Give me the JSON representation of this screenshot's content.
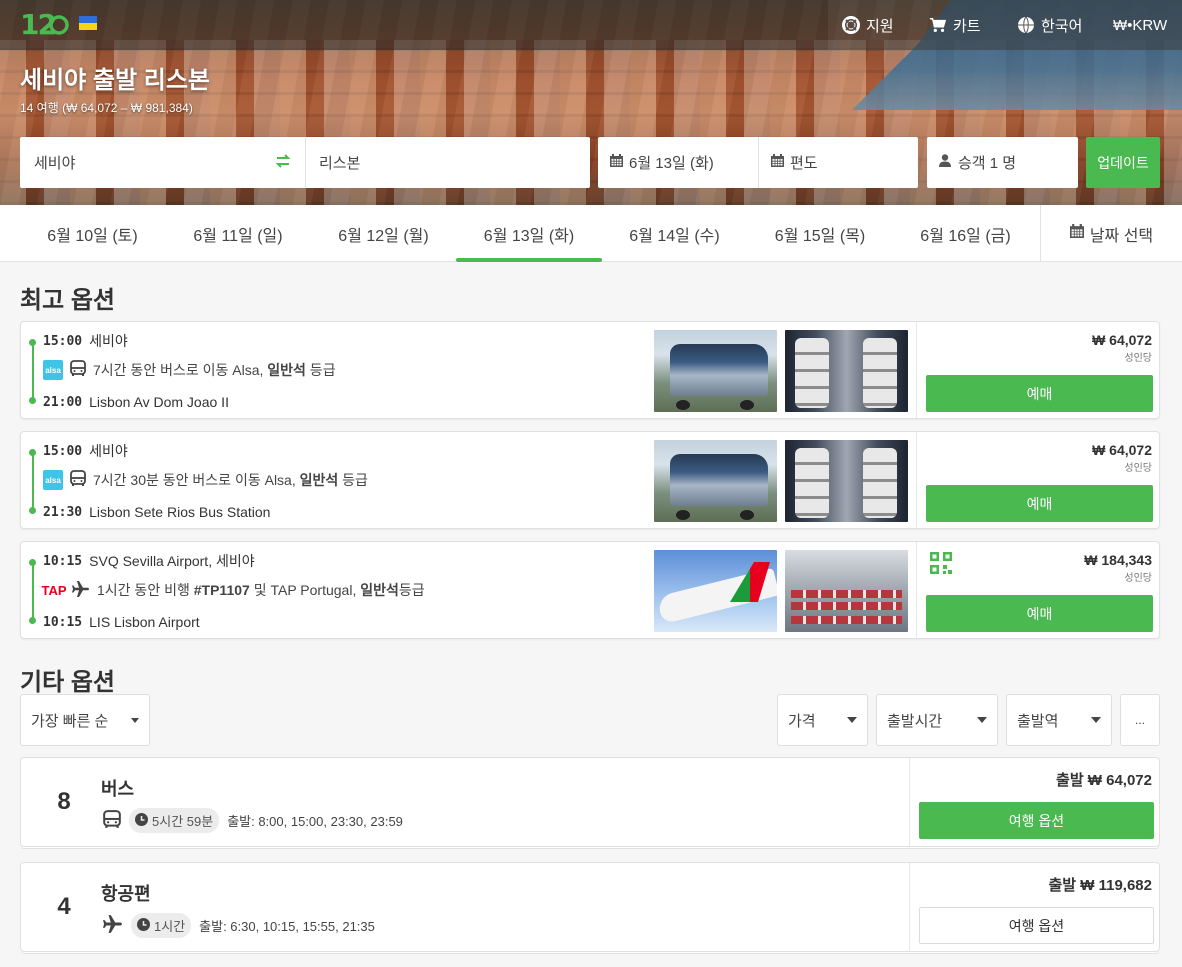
{
  "header": {
    "logo_text": "12GO",
    "nav": {
      "support": "지원",
      "cart": "카트",
      "language": "한국어",
      "currency": "₩•KRW"
    }
  },
  "route": {
    "title": "세비야 출발 리스본",
    "summary": "14 여행 (₩ 64,072 – ₩ 981,384)"
  },
  "search": {
    "from": "세비야",
    "to": "리스본",
    "date": "6월 13일 (화)",
    "trip_type": "편도",
    "passengers": "승객 1 명",
    "update_label": "업데이트"
  },
  "date_tabs": [
    {
      "label": "6월 10일 (토)",
      "active": false
    },
    {
      "label": "6월 11일 (일)",
      "active": false
    },
    {
      "label": "6월 12일 (월)",
      "active": false
    },
    {
      "label": "6월 13일 (화)",
      "active": true
    },
    {
      "label": "6월 14일 (수)",
      "active": false
    },
    {
      "label": "6월 15일 (목)",
      "active": false
    },
    {
      "label": "6월 16일 (금)",
      "active": false
    }
  ],
  "pick_date_label": "날짜 선택",
  "best_title": "최고 옵션",
  "best_options": [
    {
      "dep_time": "15:00",
      "dep_place": "세비야",
      "operator_logo": "alsa",
      "mode_icon": "bus-icon",
      "desc_pre": "7시간 동안 버스로 이동 Alsa, ",
      "desc_bold": "일반석",
      "desc_post": " 등급",
      "arr_time": "21:00",
      "arr_place": "Lisbon Av Dom Joao II",
      "price": "₩ 64,072",
      "per": "성인당",
      "book": "예매"
    },
    {
      "dep_time": "15:00",
      "dep_place": "세비야",
      "operator_logo": "alsa",
      "mode_icon": "bus-icon",
      "desc_pre": "7시간 30분 동안 버스로 이동 Alsa, ",
      "desc_bold": "일반석",
      "desc_post": " 등급",
      "arr_time": "21:30",
      "arr_place": "Lisbon Sete Rios Bus Station",
      "price": "₩ 64,072",
      "per": "성인당",
      "book": "예매"
    },
    {
      "dep_time": "10:15",
      "dep_place": "SVQ Sevilla Airport, 세비야",
      "operator_logo": "TAP",
      "mode_icon": "plane-icon",
      "desc_pre": "1시간 동안 비행 ",
      "desc_flight": "#TP1107",
      "desc_mid": " 및 TAP Portugal, ",
      "desc_bold": "일반석",
      "desc_post": "등급",
      "arr_time": "10:15",
      "arr_place": "LIS Lisbon Airport",
      "price": "₩ 184,343",
      "per": "성인당",
      "book": "예매"
    }
  ],
  "other_title": "기타 옵션",
  "filters": {
    "sort": "가장 빠른 순",
    "price": "가격",
    "departure_time": "출발시간",
    "departure_station": "출발역",
    "more": "..."
  },
  "groups": [
    {
      "count": "8",
      "name": "버스",
      "icon": "bus-icon",
      "duration": "5시간 59분",
      "departures": "출발: 8:00, 15:00, 23:30, 23:59",
      "price": "출발 ₩ 64,072",
      "button": "여행 옵션",
      "style": "green"
    },
    {
      "count": "4",
      "name": "항공편",
      "icon": "plane-icon",
      "duration": "1시간",
      "departures": "출발: 6:30, 10:15, 15:55, 21:35",
      "price": "출발 ₩ 119,682",
      "button": "여행 옵션",
      "style": "white"
    }
  ],
  "colors": {
    "accent": "#4ab94f",
    "alsa": "#3ec4e6",
    "tap_red": "#e6001e"
  }
}
